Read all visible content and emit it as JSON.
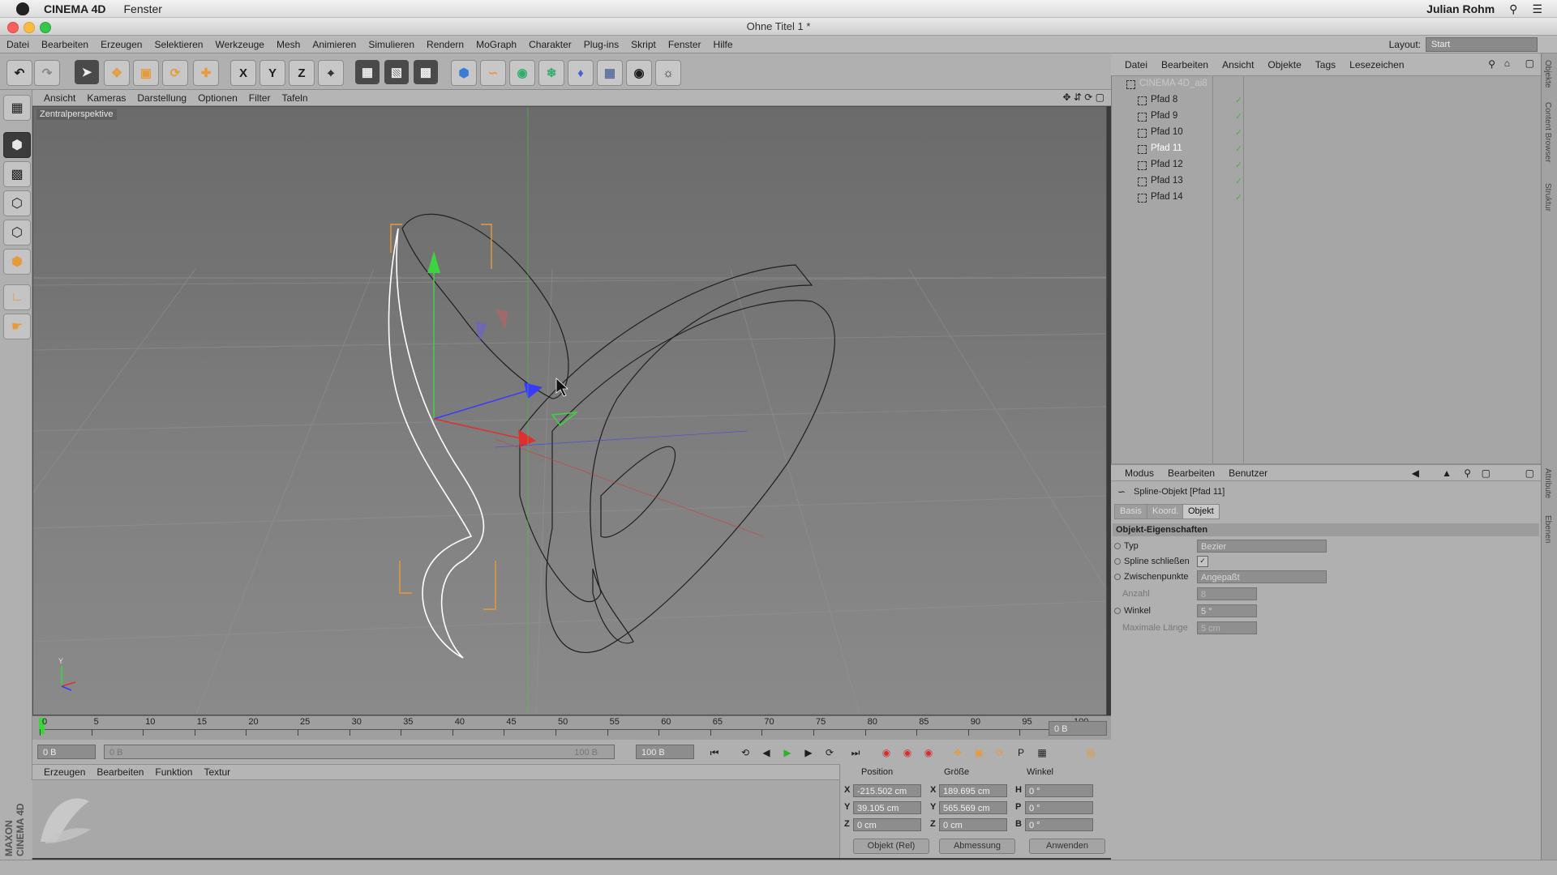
{
  "macbar": {
    "app_name": "CINEMA 4D",
    "menu_window": "Fenster",
    "user": "Julian Rohm"
  },
  "window": {
    "title": "Ohne Titel 1 *"
  },
  "mainmenu": {
    "items": [
      "Datei",
      "Bearbeiten",
      "Erzeugen",
      "Selektieren",
      "Werkzeuge",
      "Mesh",
      "Animieren",
      "Simulieren",
      "Rendern",
      "MoGraph",
      "Charakter",
      "Plug-ins",
      "Skript",
      "Fenster",
      "Hilfe"
    ],
    "layout_label": "Layout:",
    "layout_value": "Start"
  },
  "toolbar": {
    "axis_x": "X",
    "axis_y": "Y",
    "axis_z": "Z"
  },
  "viewport": {
    "menu": [
      "Ansicht",
      "Kameras",
      "Darstellung",
      "Optionen",
      "Filter",
      "Tafeln"
    ],
    "label": "Zentralperspektive",
    "axis_y": "Y"
  },
  "timeline": {
    "ticks": [
      "0",
      "5",
      "10",
      "15",
      "20",
      "25",
      "30",
      "35",
      "40",
      "45",
      "50",
      "55",
      "60",
      "65",
      "70",
      "75",
      "80",
      "85",
      "90",
      "95",
      "100"
    ],
    "current_frame": "0 B"
  },
  "transport": {
    "start": "0 B",
    "range_start": "0 B",
    "range_end": "100 B",
    "end": "100 B"
  },
  "material": {
    "menu": [
      "Erzeugen",
      "Bearbeiten",
      "Funktion",
      "Textur"
    ]
  },
  "coords": {
    "headers": [
      "Position",
      "Größe",
      "Winkel"
    ],
    "pos": {
      "x": "-215.502 cm",
      "y": "39.105 cm",
      "z": "0 cm"
    },
    "size": {
      "x": "189.695 cm",
      "y": "565.569 cm",
      "z": "0 cm"
    },
    "rot": {
      "h": "0 °",
      "p": "0 °",
      "b": "0 °"
    },
    "labels": {
      "x": "X",
      "y": "Y",
      "z": "Z",
      "h": "H",
      "p": "P",
      "b": "B"
    },
    "mode": "Objekt (Rel)",
    "measure": "Abmessung",
    "apply": "Anwenden"
  },
  "objects": {
    "menu": [
      "Datei",
      "Bearbeiten",
      "Ansicht",
      "Objekte",
      "Tags",
      "Lesezeichen"
    ],
    "root": "CINEMA 4D_ai8",
    "items": [
      "Pfad 8",
      "Pfad 9",
      "Pfad 10",
      "Pfad 11",
      "Pfad 12",
      "Pfad 13",
      "Pfad 14"
    ],
    "selected_index": 3
  },
  "attributes": {
    "menu": [
      "Modus",
      "Bearbeiten",
      "Benutzer"
    ],
    "object_title": "Spline-Objekt [Pfad 11]",
    "tabs": [
      "Basis",
      "Koord.",
      "Objekt"
    ],
    "active_tab": "Objekt",
    "section": "Objekt-Eigenschaften",
    "props": {
      "typ_label": "Typ",
      "typ_value": "Bezier",
      "close_label": "Spline schließen",
      "inter_label": "Zwischenpunkte",
      "inter_value": "Angepaßt",
      "count_label": "Anzahl",
      "count_value": "8",
      "angle_label": "Winkel",
      "angle_value": "5 °",
      "maxlen_label": "Maximale Länge",
      "maxlen_value": "5 cm"
    }
  },
  "rightstrip": {
    "tabs": [
      "Objekte",
      "Content Browser",
      "Struktur",
      "Attribute",
      "Ebenen"
    ]
  },
  "branding": {
    "logo_text": "MAXON CINEMA 4D"
  },
  "colors": {
    "accent_selected": "#ffffff",
    "axis_x": "#e0302d",
    "axis_y": "#3dd43d",
    "axis_z": "#3a3aff",
    "orange": "#e69a3c"
  }
}
